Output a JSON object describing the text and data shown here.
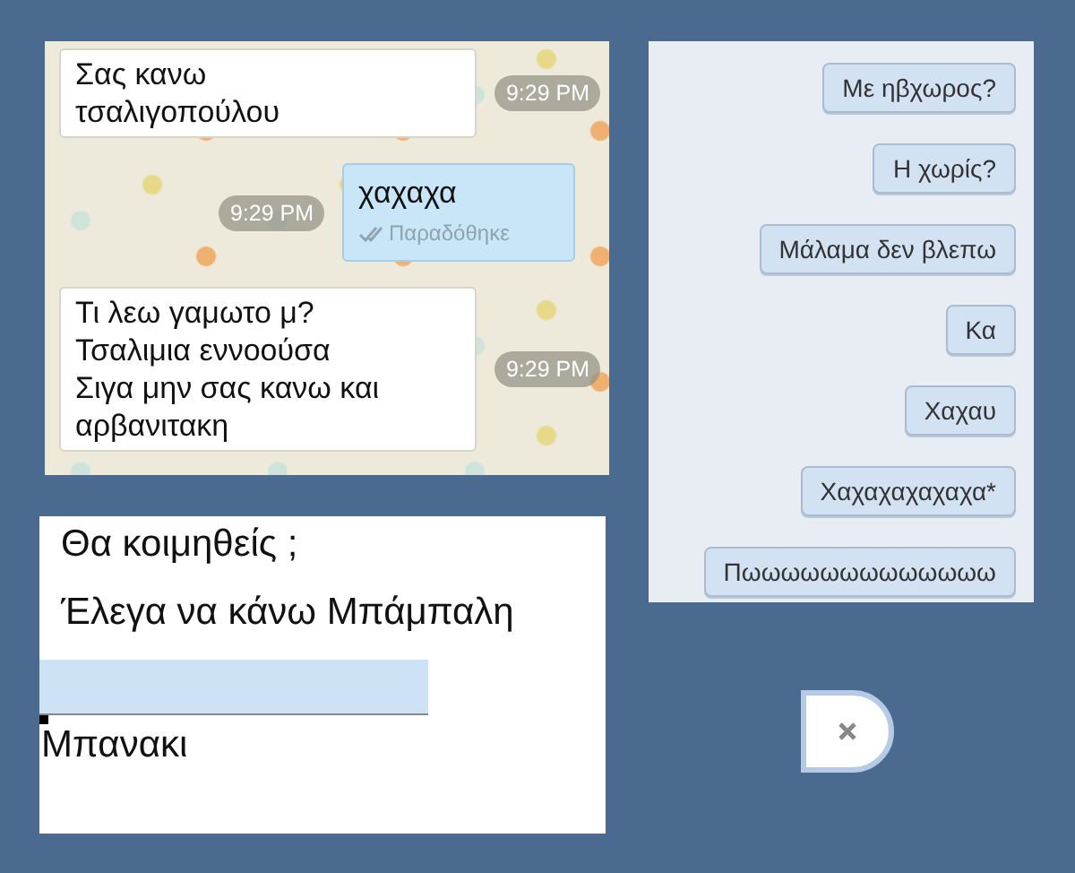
{
  "chat_a": {
    "messages": [
      {
        "kind": "incoming",
        "text": "Σας κανω\nτσαλιγοπούλου",
        "time": "9:29 PM"
      },
      {
        "kind": "outgoing",
        "text": "χαχαχα",
        "status": "Παραδόθηκε",
        "time": "9:29 PM"
      },
      {
        "kind": "incoming",
        "text": "Τι λεω γαμωτο μ?\nΤσαλιμια εννοούσα\nΣιγα μην σας κανω και\nαρβανιτακη",
        "time": "9:29 PM"
      }
    ]
  },
  "chat_b": {
    "messages": [
      "Με ηβχωρος?",
      "Η χωρίς?",
      "Μάλαμα δεν βλεπω",
      "Κα",
      "Χαχαυ",
      "Χαχαχαχαχαχα*",
      "Πωωωωωωωωωωωωω"
    ]
  },
  "note": {
    "lines": [
      "Θα κοιμηθείς ;",
      "Έλεγα να κάνω Μπάμπαλη"
    ],
    "after_field": "Μπανακι"
  }
}
